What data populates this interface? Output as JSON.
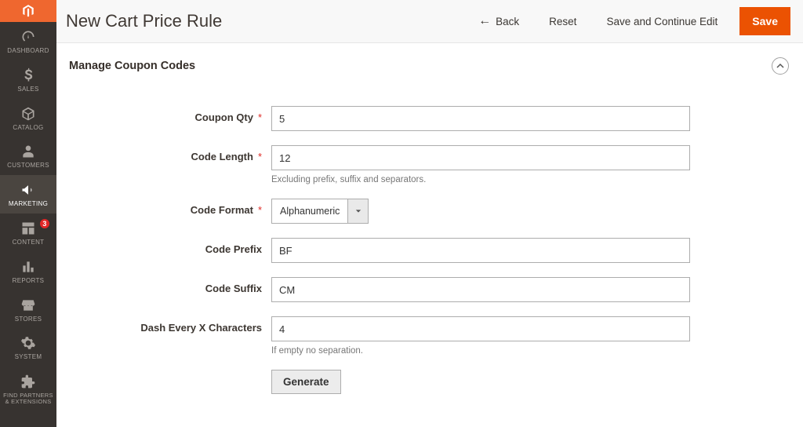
{
  "header": {
    "title": "New Cart Price Rule",
    "back": "Back",
    "reset": "Reset",
    "save_continue": "Save and Continue Edit",
    "save": "Save"
  },
  "sidebar": {
    "items": [
      {
        "id": "dashboard",
        "label": "DASHBOARD"
      },
      {
        "id": "sales",
        "label": "SALES"
      },
      {
        "id": "catalog",
        "label": "CATALOG"
      },
      {
        "id": "customers",
        "label": "CUSTOMERS"
      },
      {
        "id": "marketing",
        "label": "MARKETING"
      },
      {
        "id": "content",
        "label": "CONTENT",
        "badge": "3"
      },
      {
        "id": "reports",
        "label": "REPORTS"
      },
      {
        "id": "stores",
        "label": "STORES"
      },
      {
        "id": "system",
        "label": "SYSTEM"
      },
      {
        "id": "partners",
        "label": "FIND PARTNERS & EXTENSIONS"
      }
    ]
  },
  "section": {
    "title": "Manage Coupon Codes"
  },
  "form": {
    "coupon_qty": {
      "label": "Coupon Qty",
      "value": "5",
      "required": true
    },
    "code_length": {
      "label": "Code Length",
      "value": "12",
      "required": true,
      "help": "Excluding prefix, suffix and separators."
    },
    "code_format": {
      "label": "Code Format",
      "value": "Alphanumeric",
      "required": true
    },
    "code_prefix": {
      "label": "Code Prefix",
      "value": "BF"
    },
    "code_suffix": {
      "label": "Code Suffix",
      "value": "CM"
    },
    "dash_every": {
      "label": "Dash Every X Characters",
      "value": "4",
      "help": "If empty no separation."
    },
    "generate": "Generate"
  }
}
